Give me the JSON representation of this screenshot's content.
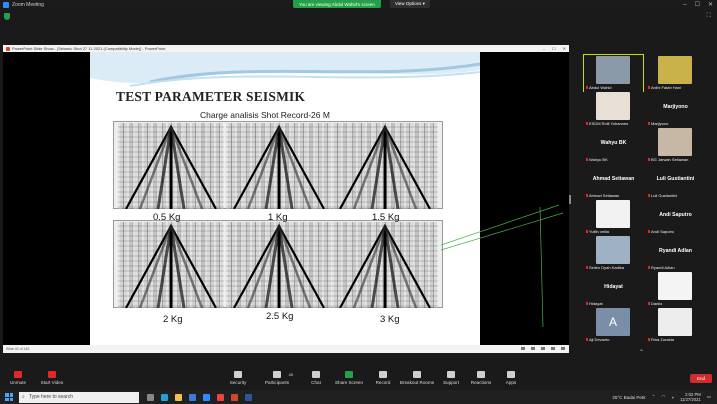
{
  "window": {
    "title": "Zoom Meeting",
    "minimize": "–",
    "maximize": "☐",
    "close": "✕"
  },
  "banner": {
    "viewing": "You are viewing Abdul Wahid's screen",
    "view_options": "View Options ▾"
  },
  "ppt": {
    "title": "PowerPoint Slide Show - [Seismic Shot 27 11 2021 (Compatibility Mode)] - PowerPoint",
    "status": "Slide 42 of 140"
  },
  "slide": {
    "title": "TEST PARAMETER SEISMIK",
    "subtitle": "Charge analisis Shot Record-26 M",
    "labels_top": [
      "0.5 Kg",
      "1 Kg",
      "1.5 Kg"
    ],
    "labels_bottom": [
      "2 Kg",
      "2.5 Kg",
      "3 Kg"
    ]
  },
  "participants": [
    {
      "name": "Abdul Wahid",
      "video": true,
      "bg": "#8a9aa8"
    },
    {
      "name": "Ardhi Fatah Hani",
      "video": true,
      "bg": "#c9b24a"
    },
    {
      "name": "ESDM Rolli Yohannes",
      "video": true,
      "bg": "#e8e0d6"
    },
    {
      "name": "Marjiyono",
      "video": false
    },
    {
      "name": "Wahyu BK",
      "video": false
    },
    {
      "name": "BG Jarwan Setiawan",
      "video": true,
      "bg": "#c7b8a6"
    },
    {
      "name": "Ahmad Setiawan",
      "video": false
    },
    {
      "name": "Luli Gustiantini",
      "video": false
    },
    {
      "name": "Yulfin vellia",
      "video": true,
      "bg": "#f2f2f2"
    },
    {
      "name": "Andi Saputro",
      "video": false
    },
    {
      "name": "Seilen Dyah Kartika",
      "video": true,
      "bg": "#9fb2c4"
    },
    {
      "name": "Ryandi Adlan",
      "video": false
    },
    {
      "name": "Hidayat",
      "video": false
    },
    {
      "name": "Danilo",
      "video": true,
      "bg": "#f4f4f4"
    },
    {
      "name": "Ajl Devanto",
      "video": true,
      "bg": "#7b8ea8",
      "initial": "A"
    },
    {
      "name": "Rina Zuraida",
      "video": true,
      "bg": "#ededed"
    }
  ],
  "toolbar": {
    "unmute": "Unmute",
    "start_video": "Start Video",
    "security": "Security",
    "participants": "Participants",
    "participants_count": "45",
    "chat": "Chat",
    "share_screen": "Share Screen",
    "record": "Record",
    "breakout": "Breakout Rooms",
    "support": "Support",
    "reactions": "Reactions",
    "apps": "Apps",
    "end": "End"
  },
  "taskbar": {
    "search": "Type here to search",
    "weather": "25°C  Badai Petir",
    "time": "2:02 PM",
    "date": "11/27/2021"
  }
}
